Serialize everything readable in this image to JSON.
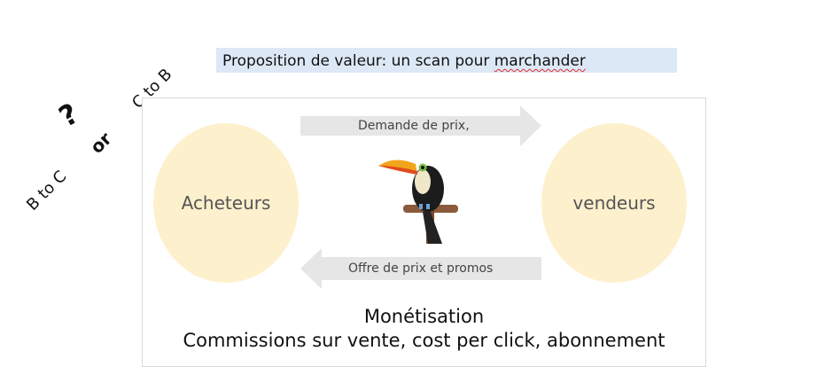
{
  "title": {
    "before": "Proposition de valeur: un scan pour ",
    "flagged": "marchander"
  },
  "side_labels": {
    "b_to_c": "B to C",
    "or": "or",
    "c_to_b": "C to B",
    "question": "?"
  },
  "diagram": {
    "left_node": "Acheteurs",
    "right_node": "vendeurs",
    "top_arrow": "Demande de prix,",
    "bottom_arrow": "Offre de prix et promos",
    "monetisation_title": "Monétisation",
    "monetisation_text": "Commissions sur vente, cost per click, abonnement"
  },
  "colors": {
    "title_bg": "#dce8f5",
    "node_fill": "#fdf0cc",
    "arrow_fill": "#e6e6e6",
    "spellcheck": "#e03030"
  },
  "icons": [
    "toucan-logo"
  ]
}
